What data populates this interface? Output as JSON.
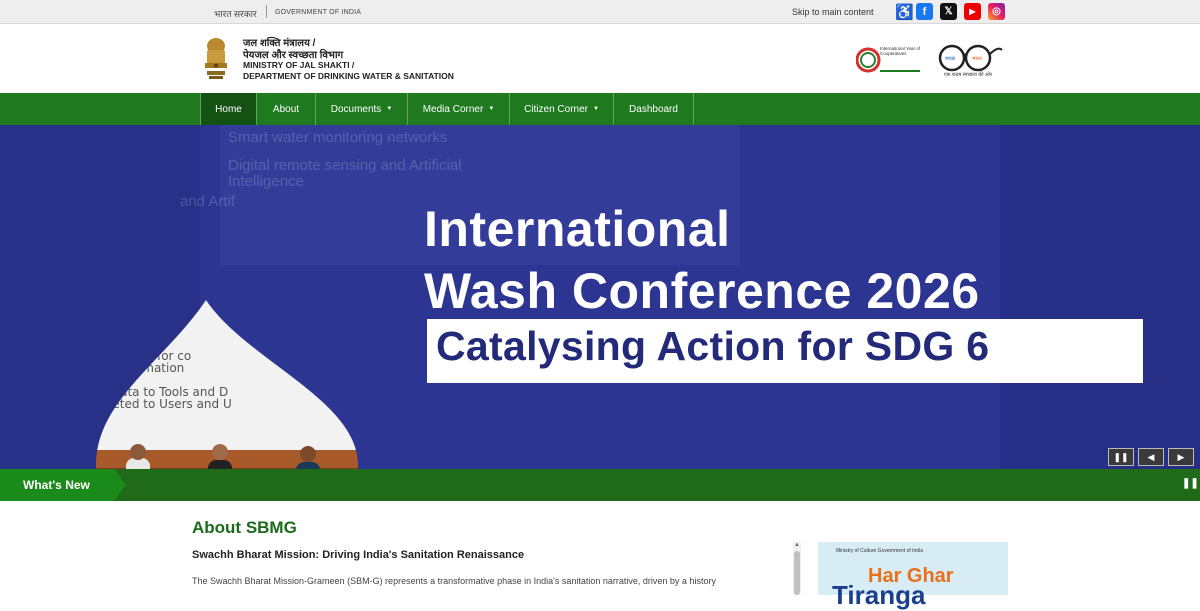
{
  "topbar": {
    "gov_hindi": "भारत सरकार",
    "gov_english": "GOVERNMENT OF INDIA",
    "skip_link": "Skip to main content",
    "social": {
      "accessibility": "♿",
      "facebook": "f",
      "x": "𝕏",
      "youtube": "▶",
      "instagram": "◎"
    }
  },
  "header": {
    "ministry_hindi_1": "जल शक्ति मंत्रालय /",
    "ministry_hindi_2": "पेयजल और स्वच्छता विभाग",
    "ministry_english_1": "MINISTRY OF JAL SHAKTI /",
    "ministry_english_2": "DEPARTMENT OF DRINKING WATER & SANITATION",
    "iyc_logo_text": "International Year of Cooperatives",
    "iyc_year": "2025",
    "swachh_tagline": "एक कदम स्वच्छता की ओर"
  },
  "nav": {
    "items": [
      {
        "label": "Home",
        "dropdown": false
      },
      {
        "label": "About",
        "dropdown": false
      },
      {
        "label": "Documents",
        "dropdown": true
      },
      {
        "label": "Media Corner",
        "dropdown": true
      },
      {
        "label": "Citizen Corner",
        "dropdown": true
      },
      {
        "label": "Dashboard",
        "dropdown": false
      }
    ],
    "caret": "▼"
  },
  "banner": {
    "title_line1": "International",
    "title_line2": "Wash Conference 2026",
    "subtitle": "Catalysing Action for SDG 6",
    "background_text": [
      "and Artif",
      "al capacity for co",
      "a to information",
      "om Data to Tools and D",
      "targeted to Users and U"
    ],
    "controls": {
      "pause": "❚❚",
      "prev": "◀",
      "next": "▶"
    }
  },
  "whats_new": {
    "label": "What's New",
    "pause": "❚❚"
  },
  "about": {
    "title": "About SBMG",
    "subtitle": "Swachh Bharat Mission: Driving India's Sanitation Renaissance",
    "body": "The Swachh Bharat Mission-Grameen (SBM-G) represents a transformative phase in India's sanitation narrative, driven by a history"
  },
  "poster": {
    "ministry": "Ministry of Culture\nGovernment of India",
    "title_line1": "Har Ghar",
    "title_line2": "Tiranga"
  },
  "colors": {
    "nav_green": "#1f7a1f",
    "banner_blue": "#2c3591",
    "heading_green": "#1a6b1a"
  }
}
